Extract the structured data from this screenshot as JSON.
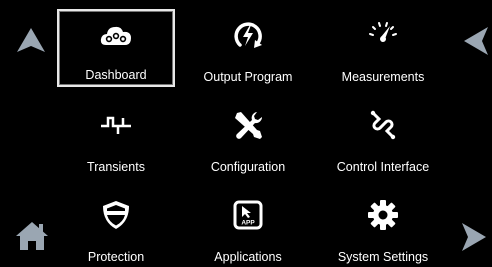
{
  "menu": {
    "items": [
      {
        "label": "Dashboard",
        "icon": "dashboard-cloud-icon",
        "selected": true
      },
      {
        "label": "Output Program",
        "icon": "output-program-bolt-icon"
      },
      {
        "label": "Measurements",
        "icon": "gauge-icon"
      },
      {
        "label": "Transients",
        "icon": "transients-waveform-icon"
      },
      {
        "label": "Configuration",
        "icon": "wrench-screwdriver-icon"
      },
      {
        "label": "Control Interface",
        "icon": "cable-connector-icon"
      },
      {
        "label": "Protection",
        "icon": "shield-icon"
      },
      {
        "label": "Applications",
        "icon": "app-icon"
      },
      {
        "label": "System Settings",
        "icon": "gear-icon"
      }
    ],
    "app_icon_text": "APP"
  },
  "nav": {
    "up": "arrow-up-icon",
    "back": "arrow-left-icon",
    "home": "home-icon",
    "next": "arrow-right-icon"
  },
  "colors": {
    "background": "#000000",
    "nav_arrow": "#9aa6b2",
    "selection_border": "#e8e8e8"
  }
}
